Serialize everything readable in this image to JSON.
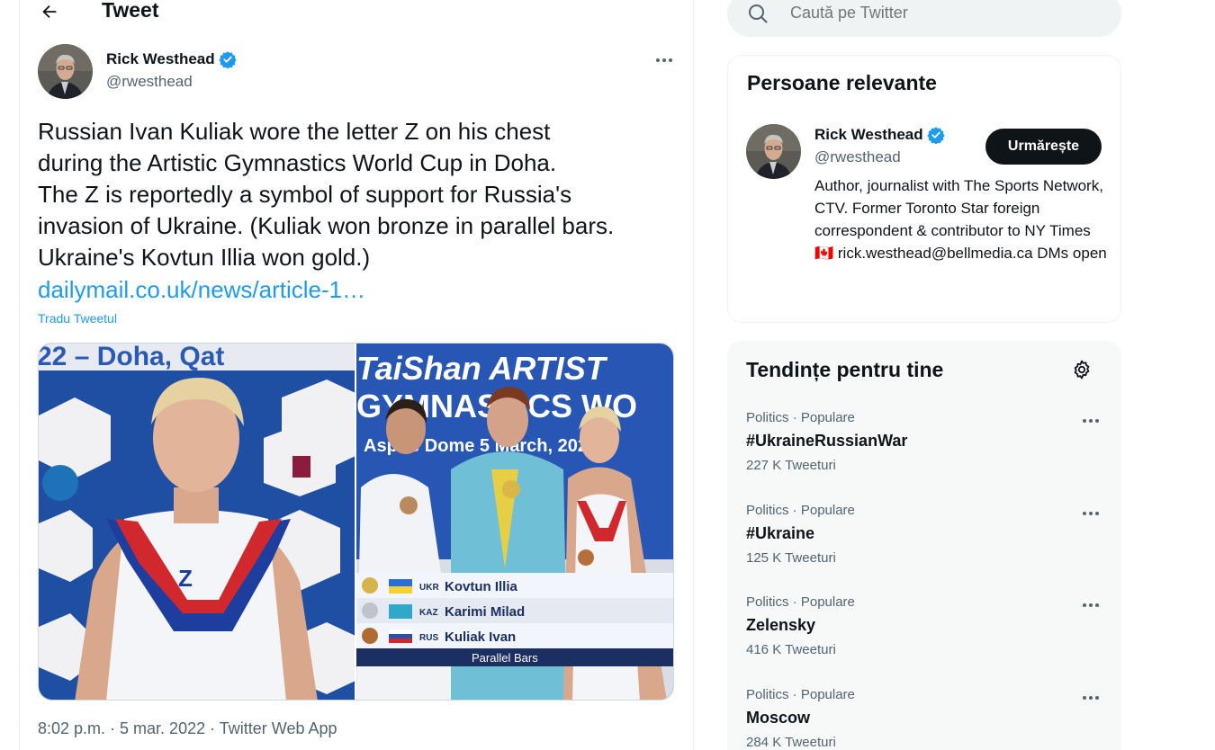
{
  "header": {
    "title": "Tweet"
  },
  "tweet": {
    "author_name": "Rick Westhead",
    "author_handle": "@rwesthead",
    "text": "Russian Ivan Kuliak wore the letter Z on his chest\nduring the Artistic Gymnastics World Cup in Doha.\nThe Z is reportedly a symbol of support for Russia's\ninvasion of Ukraine. (Kuliak won bronze in parallel bars.\nUkraine's Kovtun Illia won gold.)",
    "link": "dailymail.co.uk/news/article-1…",
    "translate": "Tradu Tweetul",
    "meta": "8:02 p.m. · 5 mar. 2022 · Twitter Web App",
    "media": {
      "left_banner": "22 – Doha, Qat",
      "right_banner_1": "TaiShan ARTIST",
      "right_banner_2": "GYMNASTICS WO",
      "right_banner_3": "Aspire Dome  5 March, 202",
      "chest_letter": "Z",
      "podium": [
        {
          "country": "UKR",
          "name": "Kovtun Illia"
        },
        {
          "country": "KAZ",
          "name": "Karimi Milad"
        },
        {
          "country": "RUS",
          "name": "Kuliak Ivan"
        }
      ],
      "event": "Parallel Bars"
    }
  },
  "search": {
    "placeholder": "Caută pe Twitter"
  },
  "relevant": {
    "title": "Persoane relevante",
    "name": "Rick Westhead",
    "handle": "@rwesthead",
    "follow_label": "Urmărește",
    "bio": "Author, journalist with The Sports Network, CTV. Former Toronto Star foreign correspondent & contributor to NY Times 🇨🇦 rick.westhead@bellmedia.ca DMs open"
  },
  "trends": {
    "title": "Tendințe pentru tine",
    "items": [
      {
        "category": "Politics · Populare",
        "name": "#UkraineRussianWar",
        "count": "227 K Tweeturi"
      },
      {
        "category": "Politics · Populare",
        "name": "#Ukraine",
        "count": "125 K Tweeturi"
      },
      {
        "category": "Politics · Populare",
        "name": "Zelensky",
        "count": "416 K Tweeturi"
      },
      {
        "category": "Politics · Populare",
        "name": "Moscow",
        "count": "284 K Tweeturi"
      }
    ]
  },
  "colors": {
    "accent": "#1d9bf0",
    "text": "#0f1419",
    "muted": "#536471",
    "verified": "#1d9bf0"
  }
}
